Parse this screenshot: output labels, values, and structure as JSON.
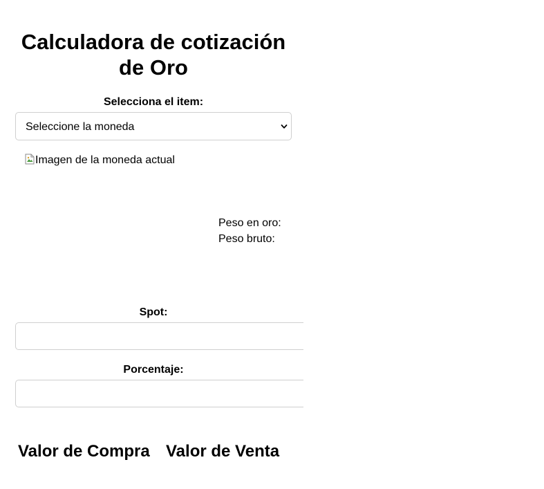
{
  "header": {
    "title": "Calculadora de cotización de Oro"
  },
  "item_selector": {
    "label": "Selecciona el item:",
    "selected": "Seleccione la moneda"
  },
  "coin_image": {
    "alt": "Imagen de la moneda actual"
  },
  "weights": {
    "gold_label": "Peso en oro:",
    "gross_label": "Peso bruto:"
  },
  "spot": {
    "label": "Spot:",
    "value": ""
  },
  "percentage": {
    "label": "Porcentaje:",
    "value": ""
  },
  "results": {
    "buy_label": "Valor de Compra",
    "sell_label": "Valor de Venta"
  }
}
